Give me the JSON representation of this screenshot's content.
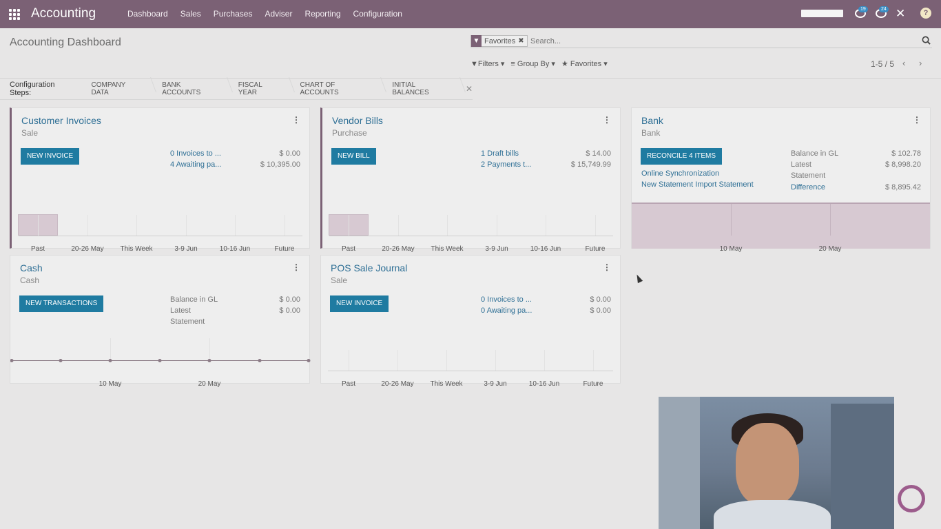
{
  "navbar": {
    "app_name": "Accounting",
    "menu": [
      "Dashboard",
      "Sales",
      "Purchases",
      "Adviser",
      "Reporting",
      "Configuration"
    ],
    "chat_badge": "19",
    "messages_badge": "24",
    "close_label": "✕",
    "help_label": "?"
  },
  "control": {
    "title": "Accounting Dashboard",
    "facet_label": "Favorites",
    "search_placeholder": "Search...",
    "filters_label": "Filters",
    "groupby_label": "Group By",
    "favorites_label": "Favorites",
    "pager": "1-5 / 5"
  },
  "steps": {
    "label": "Configuration Steps:",
    "items": [
      "COMPANY DATA",
      "BANK ACCOUNTS",
      "FISCAL YEAR",
      "CHART OF ACCOUNTS",
      "INITIAL BALANCES"
    ]
  },
  "cards": {
    "customer_invoices": {
      "title": "Customer Invoices",
      "subtitle": "Sale",
      "button": "NEW INVOICE",
      "rows": [
        {
          "label": "0 Invoices to ...",
          "value": "$ 0.00"
        },
        {
          "label": "4 Awaiting pa...",
          "value": "$ 10,395.00"
        }
      ],
      "x_labels": [
        "Past",
        "20-26 May",
        "This Week",
        "3-9 Jun",
        "10-16 Jun",
        "Future"
      ]
    },
    "vendor_bills": {
      "title": "Vendor Bills",
      "subtitle": "Purchase",
      "button": "NEW BILL",
      "rows": [
        {
          "label": "1 Draft bills",
          "value": "$ 14.00"
        },
        {
          "label": "2 Payments t...",
          "value": "$ 15,749.99"
        }
      ],
      "x_labels": [
        "Past",
        "20-26 May",
        "This Week",
        "3-9 Jun",
        "10-16 Jun",
        "Future"
      ]
    },
    "bank": {
      "title": "Bank",
      "subtitle": "Bank",
      "button": "RECONCILE 4 ITEMS",
      "link1": "Online Synchronization",
      "link2": "New Statement Import Statement",
      "balance_gl_label": "Balance in GL",
      "balance_gl_value": "$ 102.78",
      "latest_label": "Latest",
      "statement_label": "Statement",
      "latest_value": "$ 8,998.20",
      "difference_label": "Difference",
      "difference_value": "$ 8,895.42",
      "x_labels": [
        "10 May",
        "20 May"
      ]
    },
    "cash": {
      "title": "Cash",
      "subtitle": "Cash",
      "button": "NEW TRANSACTIONS",
      "balance_gl_label": "Balance in GL",
      "balance_gl_value": "$ 0.00",
      "latest_label": "Latest",
      "statement_label": "Statement",
      "latest_value": "$ 0.00",
      "x_labels": [
        "10 May",
        "20 May"
      ]
    },
    "pos": {
      "title": "POS Sale Journal",
      "subtitle": "Sale",
      "button": "NEW INVOICE",
      "rows": [
        {
          "label": "0 Invoices to ...",
          "value": "$ 0.00"
        },
        {
          "label": "0 Awaiting pa...",
          "value": "$ 0.00"
        }
      ],
      "x_labels": [
        "Past",
        "20-26 May",
        "This Week",
        "3-9 Jun",
        "10-16 Jun",
        "Future"
      ]
    }
  },
  "colors": {
    "navbar": "#7b6175",
    "button": "#1f7ba1",
    "link": "#2e6f95"
  }
}
